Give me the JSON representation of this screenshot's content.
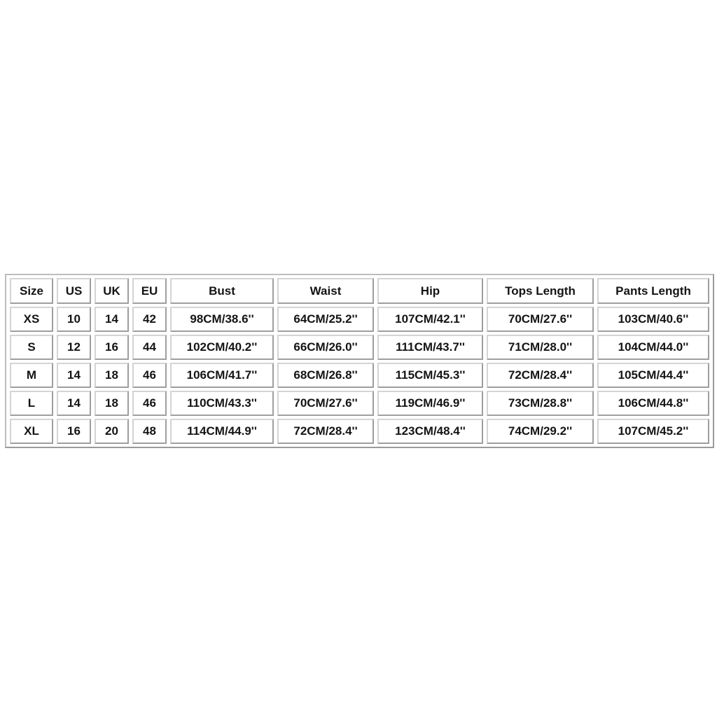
{
  "table": {
    "headers": [
      "Size",
      "US",
      "UK",
      "EU",
      "Bust",
      "Waist",
      "Hip",
      "Tops Length",
      "Pants Length"
    ],
    "rows": [
      [
        "XS",
        "10",
        "14",
        "42",
        "98CM/38.6''",
        "64CM/25.2''",
        "107CM/42.1''",
        "70CM/27.6''",
        "103CM/40.6''"
      ],
      [
        "S",
        "12",
        "16",
        "44",
        "102CM/40.2''",
        "66CM/26.0''",
        "111CM/43.7''",
        "71CM/28.0''",
        "104CM/44.0''"
      ],
      [
        "M",
        "14",
        "18",
        "46",
        "106CM/41.7''",
        "68CM/26.8''",
        "115CM/45.3''",
        "72CM/28.4''",
        "105CM/44.4''"
      ],
      [
        "L",
        "14",
        "18",
        "46",
        "110CM/43.3''",
        "70CM/27.6''",
        "119CM/46.9''",
        "73CM/28.8''",
        "106CM/44.8''"
      ],
      [
        "XL",
        "16",
        "20",
        "48",
        "114CM/44.9''",
        "72CM/28.4''",
        "123CM/48.4''",
        "74CM/29.2''",
        "107CM/45.2''"
      ]
    ]
  }
}
